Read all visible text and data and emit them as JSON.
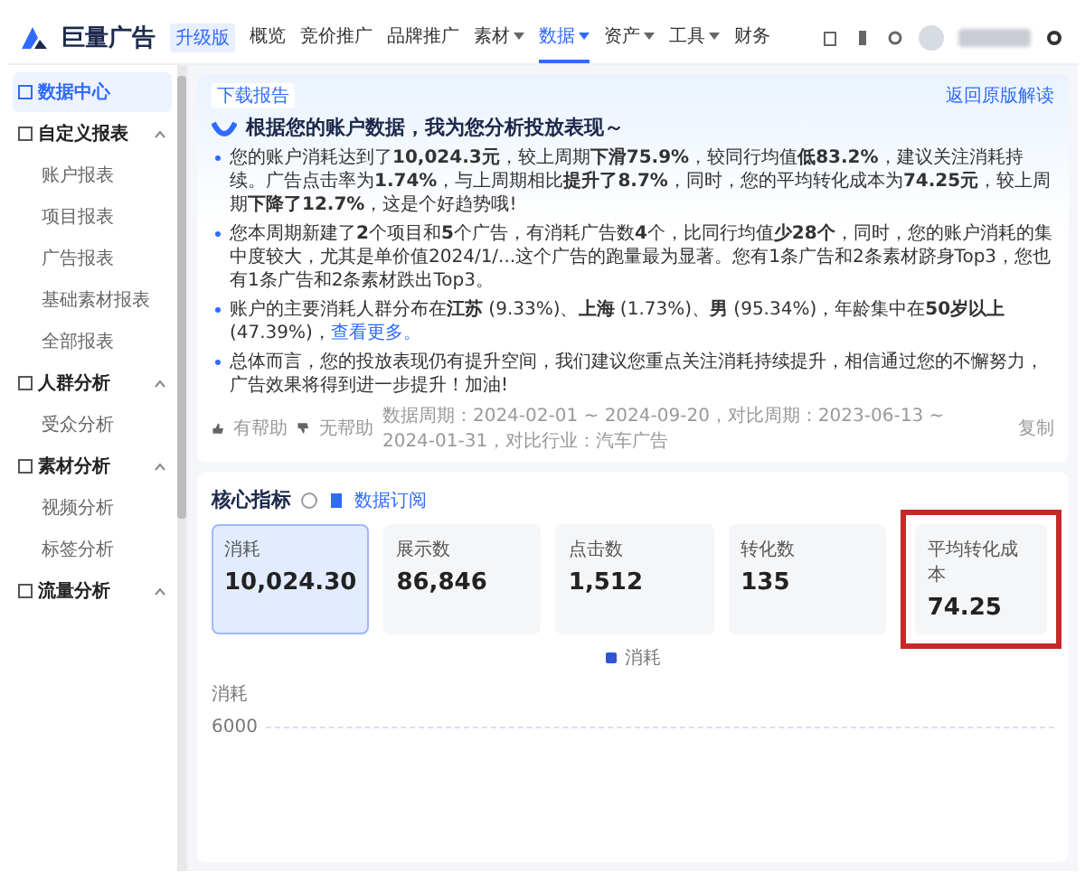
{
  "header": {
    "logo": "巨量广告",
    "edition": "升级版",
    "nav": [
      {
        "label": "概览",
        "selected": false,
        "dropdown": false
      },
      {
        "label": "竞价推广",
        "selected": false,
        "dropdown": false
      },
      {
        "label": "品牌推广",
        "selected": false,
        "dropdown": false
      },
      {
        "label": "素材",
        "selected": false,
        "dropdown": true
      },
      {
        "label": "数据",
        "selected": true,
        "dropdown": true
      },
      {
        "label": "资产",
        "selected": false,
        "dropdown": true
      },
      {
        "label": "工具",
        "selected": false,
        "dropdown": true
      },
      {
        "label": "财务",
        "selected": false,
        "dropdown": false
      }
    ]
  },
  "sidebar": {
    "items": [
      {
        "label": "数据中心",
        "selected": true,
        "expanded": false
      },
      {
        "label": "自定义报表",
        "selected": false,
        "expanded": true,
        "children": [
          {
            "label": "账户报表"
          },
          {
            "label": "项目报表"
          },
          {
            "label": "广告报表"
          },
          {
            "label": "基础素材报表"
          },
          {
            "label": "全部报表"
          }
        ]
      },
      {
        "label": "人群分析",
        "selected": false,
        "expanded": true,
        "children": [
          {
            "label": "受众分析"
          }
        ]
      },
      {
        "label": "素材分析",
        "selected": false,
        "expanded": true,
        "children": [
          {
            "label": "视频分析"
          },
          {
            "label": "标签分析"
          }
        ]
      },
      {
        "label": "流量分析",
        "selected": false,
        "expanded": true
      }
    ]
  },
  "report": {
    "tag": "下载报告",
    "back_link": "返回原版解读",
    "heading": "根据您的账户数据，我为您分析投放表现～",
    "bullets": [
      {
        "text": "您的账户消耗达到了**10,024.3元**，较上周期**下滑75.9%**，较同行均值**低83.2%**，建议关注消耗持续。广告点击率为**1.74%**，与上周期相比**提升了8.7%**，同时，您的平均转化成本为**74.25元**，较上周期**下降了12.7%**，这是个好趋势哦!"
      },
      {
        "text": "您本周期新建了**2**个项目和**5**个广告，有消耗广告数**4**个，比同行均值**少28个**，同时，您的账户消耗的集中度较大，尤其是单价值2024/1/...这个广告的跑量最为显著。您有1条广告和2条素材跻身Top3，您也有1条广告和2条素材跌出Top3。"
      },
      {
        "text": "账户的主要消耗人群分布在**江苏** (9.33%)、**上海** (1.73%)、**男** (95.34%)，年龄集中在**50岁以上** (47.39%)，",
        "link": "查看更多。"
      },
      {
        "text": "总体而言，您的投放表现仍有提升空间，我们建议您重点关注消耗持续提升，相信通过您的不懈努力，广告效果将得到进一步提升！加油!"
      }
    ],
    "helpful": "有帮助",
    "unhelpful": "无帮助",
    "period": "数据周期：2024-02-01 ~ 2024-09-20，对比周期：2023-06-13 ~ 2024-01-31，对比行业：汽车广告",
    "copy": "复制"
  },
  "metrics": {
    "title": "核心指标",
    "subscribe": "数据订阅",
    "cards": [
      {
        "label": "消耗",
        "value": "10,024.30",
        "selected": true,
        "highlighted": false
      },
      {
        "label": "展示数",
        "value": "86,846",
        "selected": false,
        "highlighted": false
      },
      {
        "label": "点击数",
        "value": "1,512",
        "selected": false,
        "highlighted": false
      },
      {
        "label": "转化数",
        "value": "135",
        "selected": false,
        "highlighted": false
      },
      {
        "label": "平均转化成本",
        "value": "74.25",
        "selected": false,
        "highlighted": true
      }
    ],
    "chart": {
      "legend": "消耗",
      "axis_label": "消耗",
      "tick": "6000"
    }
  }
}
